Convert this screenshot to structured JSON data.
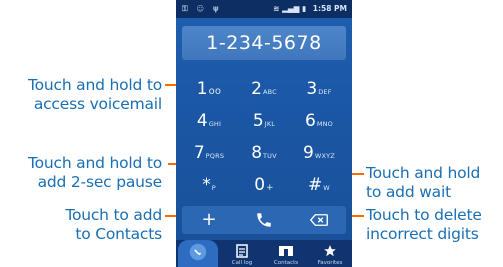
{
  "callouts": {
    "voicemail": "Touch and hold to\naccess voicemail",
    "pause": "Touch and hold to\nadd 2-sec pause",
    "add_contacts": "Touch to add\nto Contacts",
    "wait": "Touch and hold\nto add wait",
    "delete": "Touch to delete\nincorrect digits"
  },
  "status_bar": {
    "time": "1:58 PM"
  },
  "display": {
    "number": "1-234-5678"
  },
  "keys": [
    {
      "main": "1",
      "sub": "oo"
    },
    {
      "main": "2",
      "sub": "ABC"
    },
    {
      "main": "3",
      "sub": "DEF"
    },
    {
      "main": "4",
      "sub": "GHI"
    },
    {
      "main": "5",
      "sub": "JKL"
    },
    {
      "main": "6",
      "sub": "MNO"
    },
    {
      "main": "7",
      "sub": "PQRS"
    },
    {
      "main": "8",
      "sub": "TUV"
    },
    {
      "main": "9",
      "sub": "WXYZ"
    },
    {
      "main": "*",
      "sub": "P"
    },
    {
      "main": "0",
      "sub": "+"
    },
    {
      "main": "#",
      "sub": "W"
    }
  ],
  "actions": {
    "add_label": "+"
  },
  "tabs": [
    {
      "label": ""
    },
    {
      "label": "Call log"
    },
    {
      "label": "Contacts"
    },
    {
      "label": "Favorites"
    }
  ],
  "colors": {
    "accent": "#ff6a00",
    "callout_text": "#1a6fb5",
    "phone_bg": "#1b57a5"
  }
}
